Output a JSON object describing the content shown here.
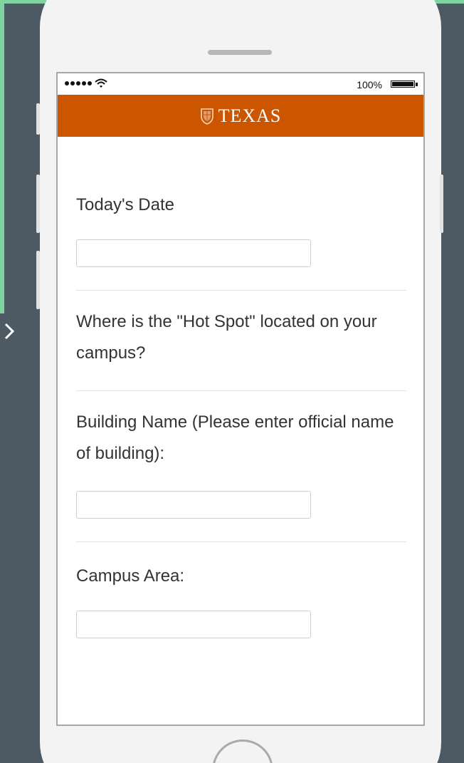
{
  "colors": {
    "background": "#4e5a63",
    "accent_green": "#7fd3a0",
    "header_orange": "#cc5500",
    "phone_body": "#f3f3f3"
  },
  "statusbar": {
    "battery_percent": "100%",
    "battery_level": 1.0,
    "signal_icon": "signal-dots-icon",
    "wifi_icon": "wifi-icon"
  },
  "header": {
    "logo_icon": "ut-seal-icon",
    "brand": "TEXAS"
  },
  "form": {
    "date_label": "Today's Date",
    "date_value": "",
    "hotspot_question": "Where is the \"Hot Spot\" located on your campus?",
    "building_label": "Building Name (Please enter official name of building):",
    "building_value": "",
    "area_label": "Campus Area:",
    "area_value": ""
  }
}
